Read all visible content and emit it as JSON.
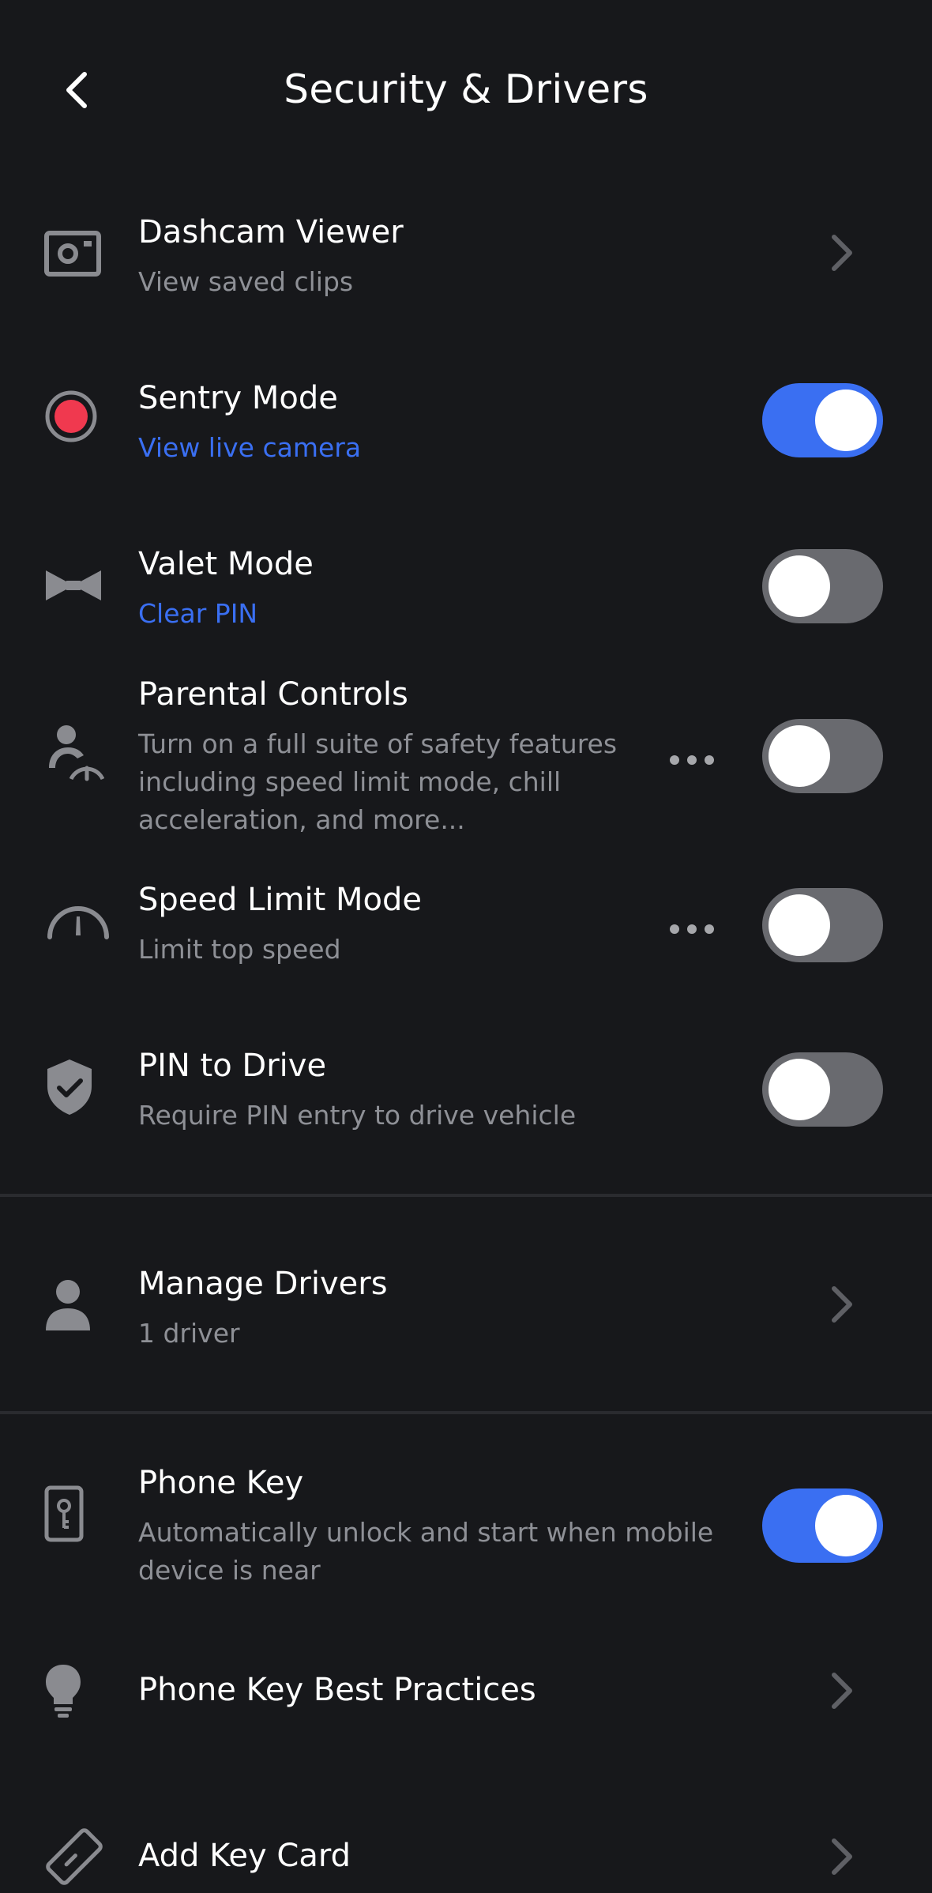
{
  "header": {
    "title": "Security & Drivers",
    "back_icon": "chevron-left-icon"
  },
  "items": [
    {
      "id": "dashcam",
      "title": "Dashcam Viewer",
      "subtitle": "View saved clips",
      "icon": "camera-icon",
      "control": "chevron"
    },
    {
      "id": "sentry",
      "title": "Sentry Mode",
      "subtitle": "View live camera",
      "icon": "sentry-record-icon",
      "control": "toggle",
      "toggle_on": true
    },
    {
      "id": "valet",
      "title": "Valet Mode",
      "subtitle": "Clear PIN",
      "icon": "bowtie-icon",
      "control": "toggle",
      "toggle_on": false
    },
    {
      "id": "parental",
      "title": "Parental Controls",
      "subtitle_lines": [
        "Turn on a full suite of safety features",
        "including speed limit mode, chill",
        "acceleration, and more..."
      ],
      "icon": "parent-child-icon",
      "control": "toggle",
      "toggle_on": false,
      "has_more": true
    },
    {
      "id": "speedlimit",
      "title": "Speed Limit Mode",
      "subtitle": "Limit top speed",
      "icon": "speedometer-icon",
      "control": "toggle",
      "toggle_on": false,
      "has_more": true
    },
    {
      "id": "pin",
      "title": "PIN to Drive",
      "subtitle": "Require PIN entry to drive vehicle",
      "icon": "shield-check-icon",
      "control": "toggle",
      "toggle_on": false
    },
    {
      "id": "drivers",
      "title": "Manage Drivers",
      "subtitle": "1 driver",
      "icon": "person-icon",
      "control": "chevron"
    },
    {
      "id": "phonekey",
      "title": "Phone Key",
      "subtitle_lines": [
        "Automatically unlock and start when mobile",
        "device is near"
      ],
      "icon": "phone-key-icon",
      "control": "toggle",
      "toggle_on": true
    },
    {
      "id": "bestpractices",
      "title": "Phone Key Best Practices",
      "icon": "lightbulb-icon",
      "control": "chevron"
    },
    {
      "id": "keycard",
      "title": "Add Key Card",
      "icon": "key-card-icon",
      "control": "chevron"
    }
  ],
  "colors": {
    "background": "#17181b",
    "accent": "#3a6ff2",
    "sentry_red": "#f0394f",
    "toggle_off": "#696a6f",
    "secondary_text": "#8e9096",
    "icon_gray": "#8a8b90"
  }
}
